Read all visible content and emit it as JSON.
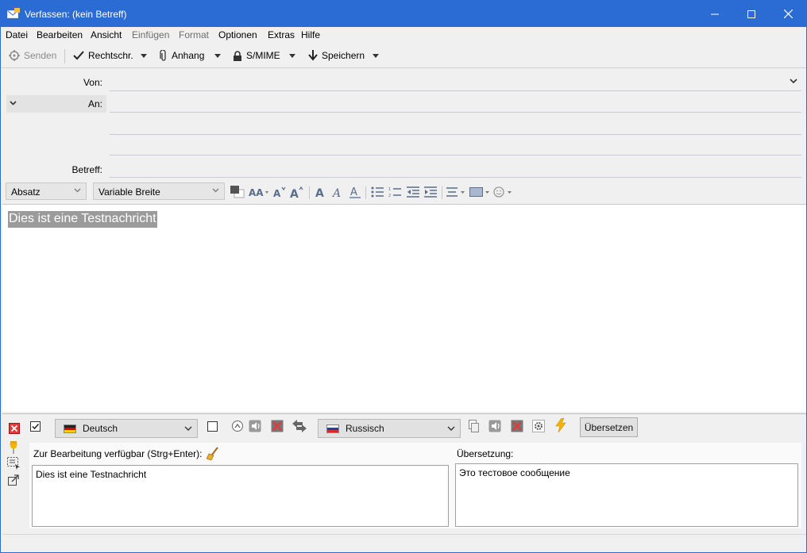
{
  "window": {
    "title": "Verfassen: (kein Betreff)"
  },
  "menu": [
    "Datei",
    "Bearbeiten",
    "Ansicht",
    "Einfügen",
    "Format",
    "Optionen",
    "Extras",
    "Hilfe"
  ],
  "toolbar": {
    "send": "Senden",
    "spell": "Rechtschr.",
    "attach": "Anhang",
    "smime": "S/MIME",
    "save": "Speichern"
  },
  "headers": {
    "from_label": "Von:",
    "to_label": "An:",
    "subject_label": "Betreff:",
    "from_value": "",
    "subject_value": ""
  },
  "format": {
    "paragraph": "Absatz",
    "font": "Variable Breite"
  },
  "body": {
    "text": "Dies ist eine Testnachricht"
  },
  "translator": {
    "source_lang": "Deutsch",
    "target_lang": "Russisch",
    "translate_button": "Übersetzen",
    "source_label": "Zur Bearbeitung verfügbar (Strg+Enter):",
    "target_label": "Übersetzung:",
    "source_text": "Dies ist eine Testnachricht",
    "target_text": "Это тестовое сообщение"
  },
  "colors": {
    "titlebar": "#2b6cd4",
    "selection": "#9b9b9b"
  }
}
